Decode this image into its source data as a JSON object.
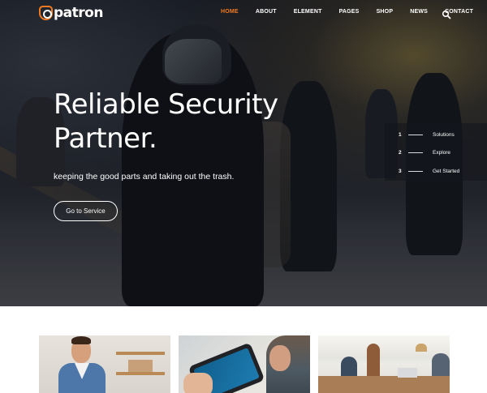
{
  "brand": {
    "name": "patron",
    "accent_color": "#f37a20"
  },
  "nav": {
    "items": [
      {
        "label": "HOME",
        "active": true
      },
      {
        "label": "ABOUT",
        "active": false
      },
      {
        "label": "ELEMENT",
        "active": false
      },
      {
        "label": "PAGES",
        "active": false
      },
      {
        "label": "SHOP",
        "active": false
      },
      {
        "label": "NEWS",
        "active": false
      },
      {
        "label": "CONTACT",
        "active": false
      }
    ],
    "search_icon": "search-icon"
  },
  "hero": {
    "headline_line1": "Reliable Security",
    "headline_line2": "Partner.",
    "subtitle": "keeping the good parts and taking out the trash.",
    "cta_label": "Go to Service"
  },
  "steps": [
    {
      "num": "1",
      "label": "Solutions"
    },
    {
      "num": "2",
      "label": "Explore"
    },
    {
      "num": "3",
      "label": "Get Started"
    }
  ]
}
